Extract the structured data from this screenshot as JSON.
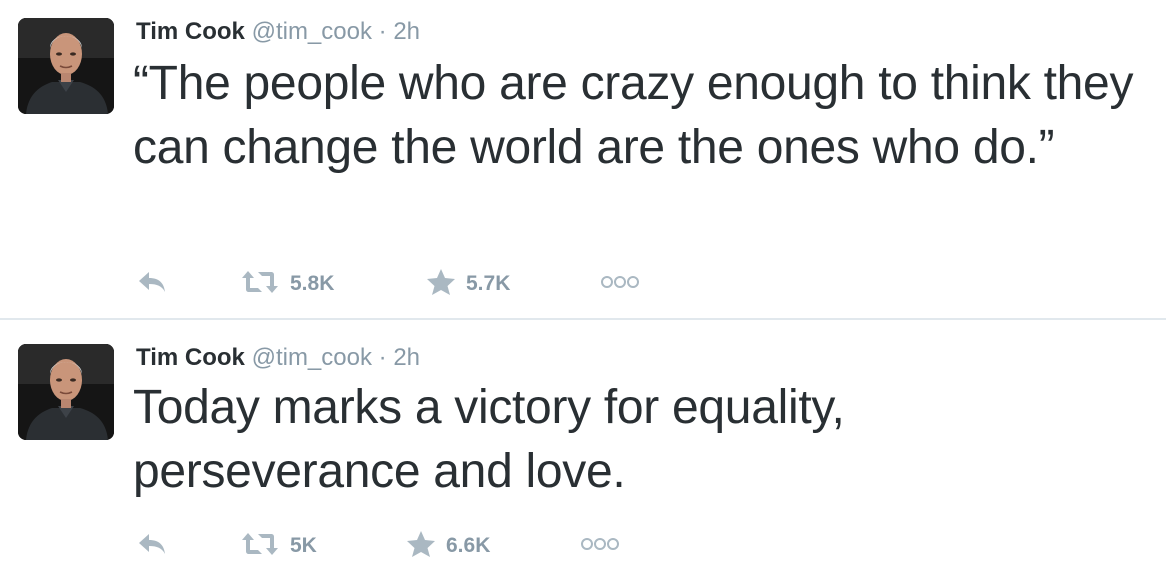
{
  "tweets": [
    {
      "author_name": "Tim Cook",
      "handle": "@tim_cook",
      "separator": "·",
      "time": "2h",
      "text": "“The people who are crazy enough to think they can change the world are the ones who do.”",
      "retweets": "5.8K",
      "favorites": "5.7K",
      "icons": [
        "reply-icon",
        "retweet-icon",
        "favorite-star-icon",
        "more-options-icon"
      ]
    },
    {
      "author_name": "Tim Cook",
      "handle": "@tim_cook",
      "separator": "·",
      "time": "2h",
      "text": "Today marks a victory for equality, perseverance and love.",
      "retweets": "5K",
      "favorites": "6.6K",
      "icons": [
        "reply-icon",
        "retweet-icon",
        "favorite-star-icon",
        "more-options-icon"
      ]
    }
  ],
  "colors": {
    "text_primary": "#292f33",
    "text_secondary": "#8899a6",
    "icon_gray": "#aab8c2",
    "divider": "#e1e8ed"
  }
}
